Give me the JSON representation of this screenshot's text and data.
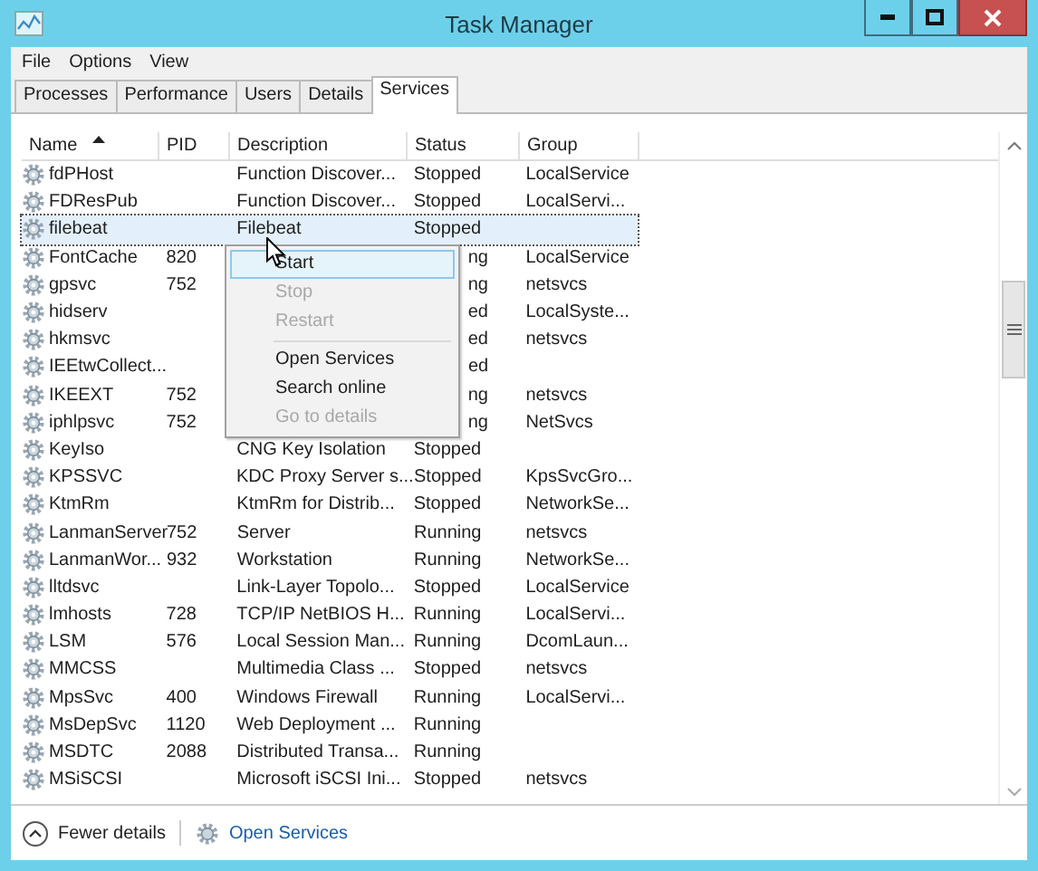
{
  "window": {
    "title": "Task Manager"
  },
  "menu_bar": [
    "File",
    "Options",
    "View"
  ],
  "tabs": [
    {
      "label": "Processes",
      "selected": false
    },
    {
      "label": "Performance",
      "selected": false
    },
    {
      "label": "Users",
      "selected": false
    },
    {
      "label": "Details",
      "selected": false
    },
    {
      "label": "Services",
      "selected": true
    }
  ],
  "table": {
    "columns": [
      {
        "label": "Name",
        "sorted": true
      },
      {
        "label": "PID",
        "sorted": false
      },
      {
        "label": "Description",
        "sorted": false
      },
      {
        "label": "Status",
        "sorted": false
      },
      {
        "label": "Group",
        "sorted": false
      }
    ],
    "rows": [
      {
        "name": "fdPHost",
        "description": "Function Discover...",
        "status": "Stopped",
        "group": "LocalService",
        "selected": false
      },
      {
        "name": "FDResPub",
        "description": "Function Discover...",
        "status": "Stopped",
        "group": "LocalServi...",
        "selected": false
      },
      {
        "name": "filebeat",
        "description": "Filebeat",
        "status": "Stopped",
        "selected": true
      },
      {
        "name": "FontCache",
        "pid": "820",
        "status_fragment": "ng",
        "group": "LocalService",
        "selected": false
      },
      {
        "name": "gpsvc",
        "pid": "752",
        "status_fragment": "ng",
        "group": "netsvcs",
        "selected": false
      },
      {
        "name": "hidserv",
        "status_fragment": "ed",
        "group": "LocalSyste...",
        "selected": false
      },
      {
        "name": "hkmsvc",
        "status_fragment": "ed",
        "group": "netsvcs",
        "selected": false
      },
      {
        "name": "IEEtwCollect...",
        "status_fragment": "ed",
        "selected": false
      },
      {
        "name": "IKEEXT",
        "pid": "752",
        "status_fragment": "ng",
        "group": "netsvcs",
        "selected": false
      },
      {
        "name": "iphlpsvc",
        "pid": "752",
        "status_fragment": "ng",
        "group": "NetSvcs",
        "selected": false
      },
      {
        "name": "KeyIso",
        "description": "CNG Key Isolation",
        "status": "Stopped",
        "selected": false
      },
      {
        "name": "KPSSVC",
        "description": "KDC Proxy Server s...",
        "status": "Stopped",
        "group": "KpsSvcGro...",
        "selected": false
      },
      {
        "name": "KtmRm",
        "description": "KtmRm for Distrib...",
        "status": "Stopped",
        "group": "NetworkSe...",
        "selected": false
      },
      {
        "name": "LanmanServer",
        "pid": "752",
        "description": "Server",
        "status": "Running",
        "group": "netsvcs",
        "selected": false
      },
      {
        "name": "LanmanWor...",
        "pid": "932",
        "description": "Workstation",
        "status": "Running",
        "group": "NetworkSe...",
        "selected": false
      },
      {
        "name": "lltdsvc",
        "description": "Link-Layer Topolo...",
        "status": "Stopped",
        "group": "LocalService",
        "selected": false
      },
      {
        "name": "lmhosts",
        "pid": "728",
        "description": "TCP/IP NetBIOS H...",
        "status": "Running",
        "group": "LocalServi...",
        "selected": false
      },
      {
        "name": "LSM",
        "pid": "576",
        "description": "Local Session Man...",
        "status": "Running",
        "group": "DcomLaun...",
        "selected": false
      },
      {
        "name": "MMCSS",
        "description": "Multimedia Class ...",
        "status": "Stopped",
        "group": "netsvcs",
        "selected": false
      },
      {
        "name": "MpsSvc",
        "pid": "400",
        "description": "Windows Firewall",
        "status": "Running",
        "group": "LocalServi...",
        "selected": false
      },
      {
        "name": "MsDepSvc",
        "pid": "1120",
        "description": "Web Deployment ...",
        "status": "Running",
        "selected": false
      },
      {
        "name": "MSDTC",
        "pid": "2088",
        "description": "Distributed Transa...",
        "status": "Running",
        "selected": false
      },
      {
        "name": "MSiSCSI",
        "description": "Microsoft iSCSI Ini...",
        "status": "Stopped",
        "group": "netsvcs",
        "selected": false
      }
    ]
  },
  "context_menu": [
    {
      "label": "Start",
      "kind": "item",
      "selected": true,
      "disabled": false
    },
    {
      "label": "Stop",
      "kind": "item",
      "selected": false,
      "disabled": true
    },
    {
      "label": "Restart",
      "kind": "item",
      "selected": false,
      "disabled": true
    },
    {
      "kind": "separator"
    },
    {
      "label": "Open Services",
      "kind": "item",
      "selected": false,
      "disabled": false
    },
    {
      "label": "Search online",
      "kind": "item",
      "selected": false,
      "disabled": false
    },
    {
      "label": "Go to details",
      "kind": "item",
      "selected": false,
      "disabled": true
    }
  ],
  "footer": {
    "toggle": "Fewer details",
    "link": "Open Services"
  }
}
